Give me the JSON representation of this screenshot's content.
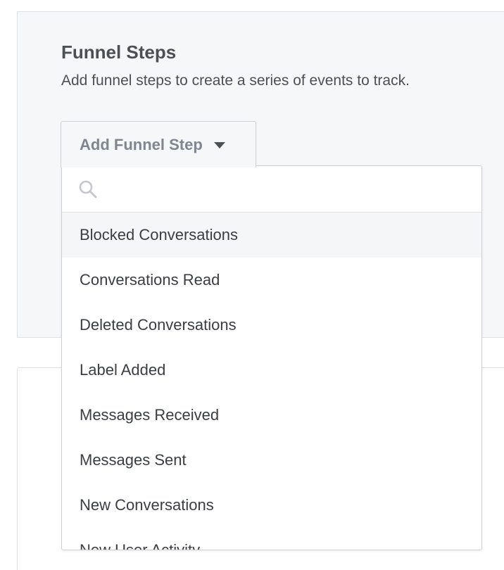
{
  "section": {
    "title": "Funnel Steps",
    "description": "Add funnel steps to create a series of events to track."
  },
  "add_step": {
    "label": "Add Funnel Step"
  },
  "dropdown": {
    "search_placeholder": "",
    "search_value": "",
    "options": [
      "Blocked Conversations",
      "Conversations Read",
      "Deleted Conversations",
      "Label Added",
      "Messages Received",
      "Messages Sent",
      "New Conversations",
      "New User Activity"
    ],
    "highlighted_index": 0
  },
  "colors": {
    "panel_background": "#f6f7f8",
    "text_primary": "#4b4f56",
    "button_text": "#7f8691",
    "option_highlight": "#f5f6f7",
    "border": "#ced0d4"
  },
  "icons": {
    "search": "search-icon",
    "caret": "caret-down-icon"
  }
}
